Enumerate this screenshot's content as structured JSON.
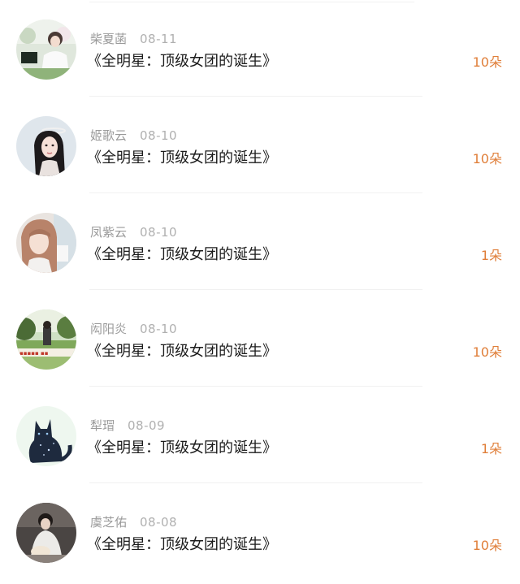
{
  "rows": [
    {
      "name": "柴夏菡",
      "date": "08-11",
      "title": "《全明星：顶级女团的诞生》",
      "gift": "10朵"
    },
    {
      "name": "姬歌云",
      "date": "08-10",
      "title": "《全明星：顶级女团的诞生》",
      "gift": "10朵"
    },
    {
      "name": "凤紫云",
      "date": "08-10",
      "title": "《全明星：顶级女团的诞生》",
      "gift": "1朵"
    },
    {
      "name": "闳阳炎",
      "date": "08-10",
      "title": "《全明星：顶级女团的诞生》",
      "gift": "10朵"
    },
    {
      "name": "犁瑁",
      "date": "08-09",
      "title": "《全明星：顶级女团的诞生》",
      "gift": "1朵"
    },
    {
      "name": "虞芝佑",
      "date": "08-08",
      "title": "《全明星：顶级女团的诞生》",
      "gift": "10朵"
    }
  ],
  "accent_color": "#e07f3a"
}
